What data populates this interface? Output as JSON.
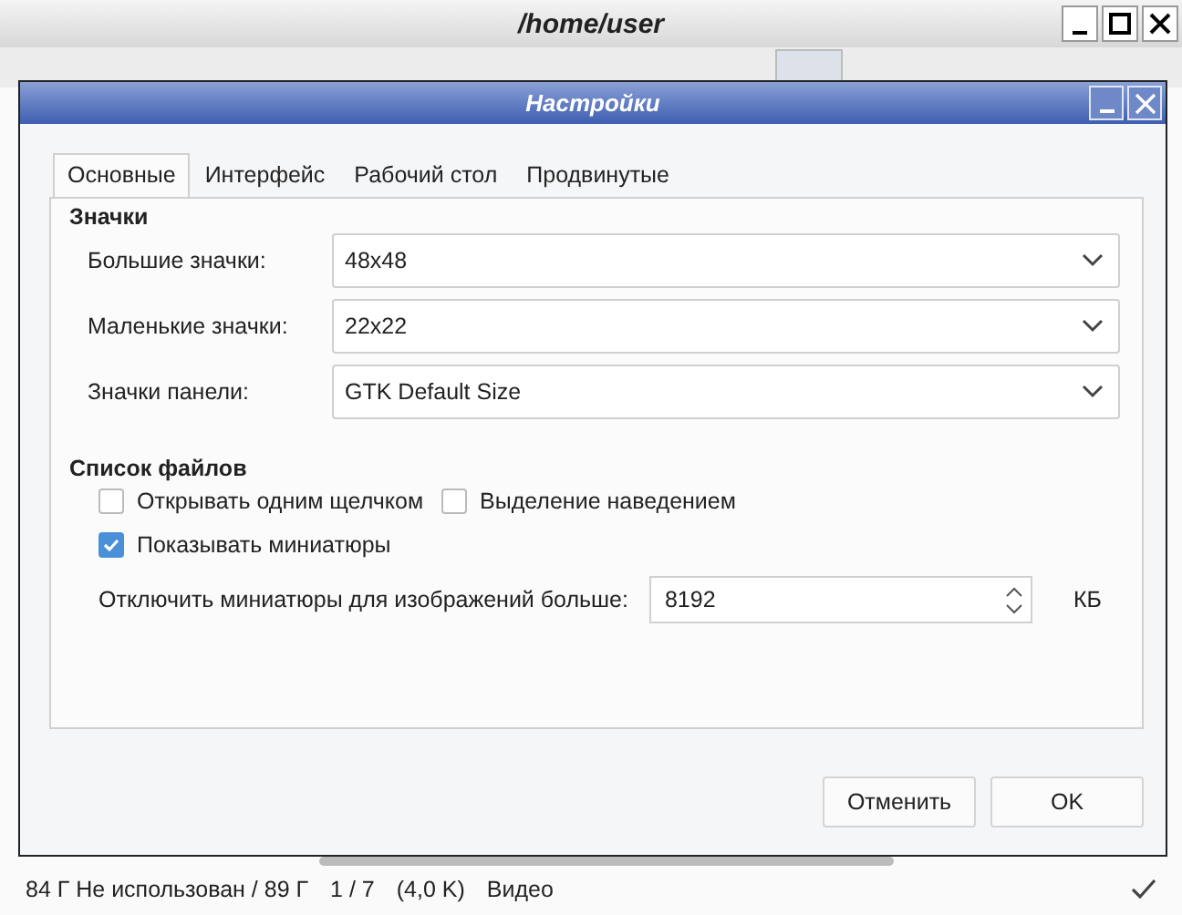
{
  "main_window": {
    "title": "/home/user",
    "status_bar": {
      "free_space": "84 Г Не использован / 89 Г",
      "count": "1 / 7",
      "size": "(4,0 K)",
      "type": "Видео"
    }
  },
  "dialog": {
    "title": "Настройки",
    "tabs": [
      {
        "label": "Основные",
        "selected": true
      },
      {
        "label": "Интерфейс",
        "selected": false
      },
      {
        "label": "Рабочий стол",
        "selected": false
      },
      {
        "label": "Продвинутые",
        "selected": false
      }
    ],
    "icons_section": {
      "heading": "Значки",
      "rows": [
        {
          "label": "Большие значки:",
          "value": "48x48"
        },
        {
          "label": "Маленькие значки:",
          "value": "22x22"
        },
        {
          "label": "Значки панели:",
          "value": "GTK Default Size"
        }
      ]
    },
    "file_list_section": {
      "heading": "Список файлов",
      "checkbox_rows": [
        [
          {
            "label": "Открывать одним щелчком",
            "checked": false
          },
          {
            "label": "Выделение наведением",
            "checked": false
          }
        ],
        [
          {
            "label": "Показывать миниатюры",
            "checked": true
          }
        ]
      ],
      "thumbnail_limit": {
        "label": "Отключить миниатюры для изображений больше:",
        "value": "8192",
        "unit": "КБ"
      }
    },
    "buttons": [
      "Отменить",
      "OK"
    ]
  }
}
